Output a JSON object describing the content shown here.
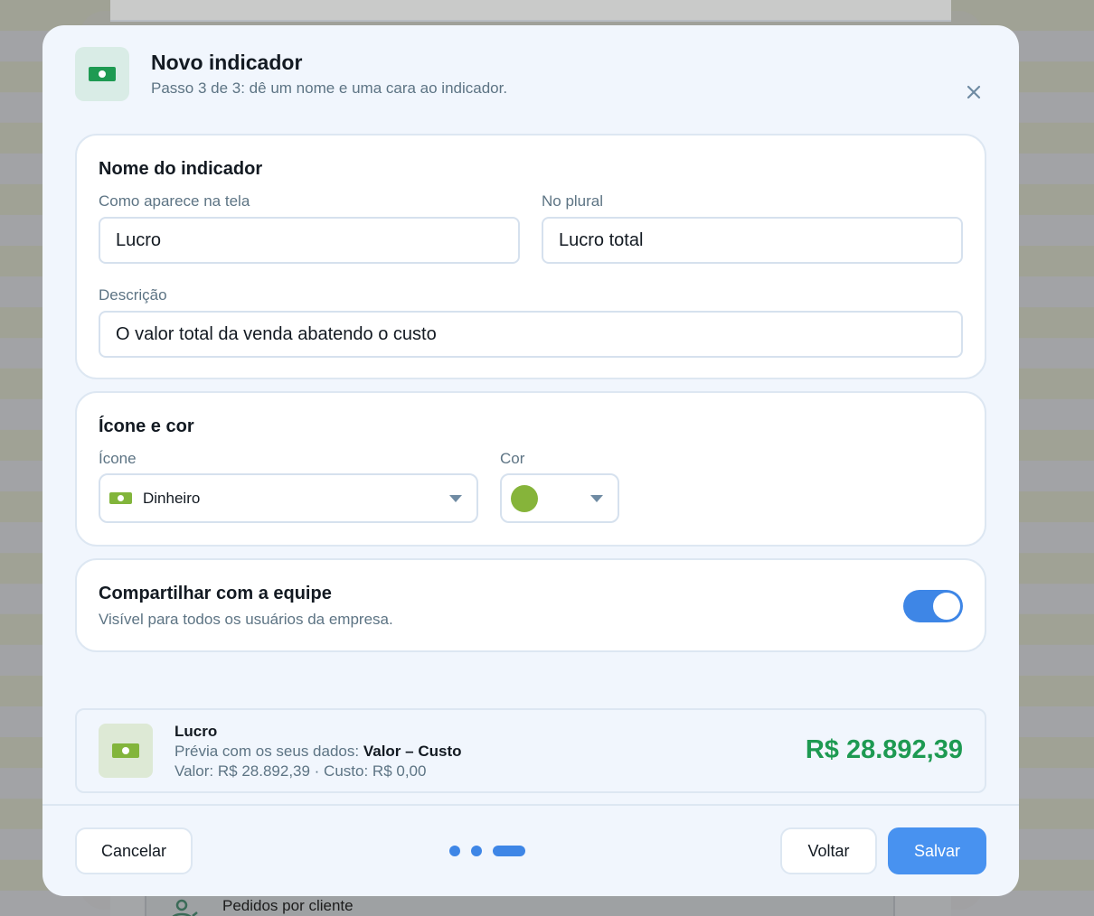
{
  "background": {
    "list_item_label": "Pedidos por cliente"
  },
  "dialog": {
    "title": "Novo indicador",
    "subtitle": "Passo 3 de 3: dê um nome e uma cara ao indicador.",
    "close_icon": "close-icon"
  },
  "name_section": {
    "title": "Nome do indicador",
    "display_label": "Como aparece na tela",
    "display_value": "Lucro",
    "plural_label": "No plural",
    "plural_value": "Lucro total",
    "description_label": "Descrição",
    "description_value": "O valor total da venda abatendo o custo"
  },
  "appearance_section": {
    "title": "Ícone e cor",
    "icon_label": "Ícone",
    "icon_value": "Dinheiro",
    "icon_name": "money-bill-icon",
    "color_label": "Cor",
    "color_value": "#86b43a"
  },
  "share_section": {
    "title": "Compartilhar com a equipe",
    "description": "Visível para todos os usuários da empresa.",
    "enabled": true
  },
  "preview": {
    "name": "Lucro",
    "prefix": "Prévia com os seus dados:",
    "formula": "Valor – Custo",
    "details": "Valor: R$ 28.892,39  ·  Custo: R$ 0,00",
    "amount": "R$ 28.892,39"
  },
  "footer": {
    "cancel_label": "Cancelar",
    "back_label": "Voltar",
    "save_label": "Salvar",
    "current_step": 3,
    "total_steps": 3
  },
  "colors": {
    "accent": "#4892f0",
    "positive": "#1e9a52"
  }
}
